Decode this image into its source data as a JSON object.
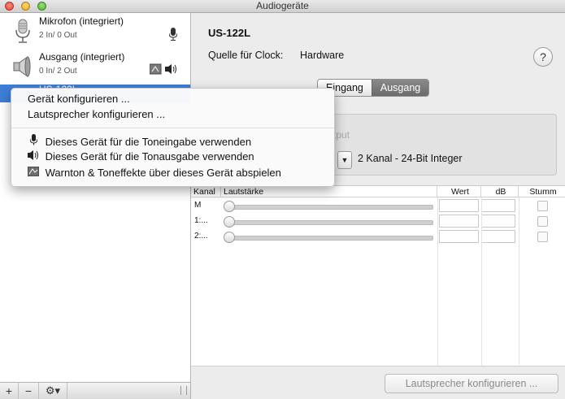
{
  "window": {
    "title": "Audiogeräte"
  },
  "sidebar": {
    "devices": [
      {
        "name": "Mikrofon (integriert)",
        "io": "2 In/ 0 Out",
        "icon": "microphone-icon"
      },
      {
        "name": "Ausgang (integriert)",
        "io": "0 In/ 2 Out",
        "icon": "speaker-icon"
      },
      {
        "name": "US-122L",
        "io": "",
        "icon": "usb-audio-icon"
      }
    ],
    "toolbar": {
      "add": "+",
      "remove": "−",
      "gear": "⚙▾"
    }
  },
  "detail": {
    "device_title": "US-122L",
    "clock_label": "Quelle für Clock:",
    "clock_value": "Hardware",
    "help": "?",
    "tabs": [
      "Eingang",
      "Ausgang"
    ],
    "active_tab": "Ausgang",
    "ghost_label": "tput",
    "format": "2 Kanal - 24-Bit Integer"
  },
  "table": {
    "headers": {
      "channel": "Kanal",
      "volume": "Lautstärke",
      "value": "Wert",
      "db": "dB",
      "mute": "Stumm"
    },
    "rows": [
      {
        "channel": "M",
        "value": "",
        "db": "",
        "muted": false
      },
      {
        "channel": "1:...",
        "value": "",
        "db": "",
        "muted": false
      },
      {
        "channel": "2:...",
        "value": "",
        "db": "",
        "muted": false
      }
    ]
  },
  "bottom": {
    "speaker_button": "Lautsprecher konfigurieren ..."
  },
  "context_menu": {
    "items": [
      {
        "label": "Gerät konfigurieren ...",
        "icon": ""
      },
      {
        "label": "Lautsprecher konfigurieren ...",
        "icon": ""
      },
      {
        "label": "Dieses Gerät für die Toneingabe verwenden",
        "icon": "microphone-icon"
      },
      {
        "label": "Dieses Gerät für die Tonausgabe verwenden",
        "icon": "speaker-icon"
      },
      {
        "label": "Warnton & Toneffekte über dieses Gerät abspielen",
        "icon": "alert-sound-icon"
      }
    ]
  },
  "colors": {
    "selection": "#3d7fd6",
    "tab_active": "#6b6b6b"
  }
}
